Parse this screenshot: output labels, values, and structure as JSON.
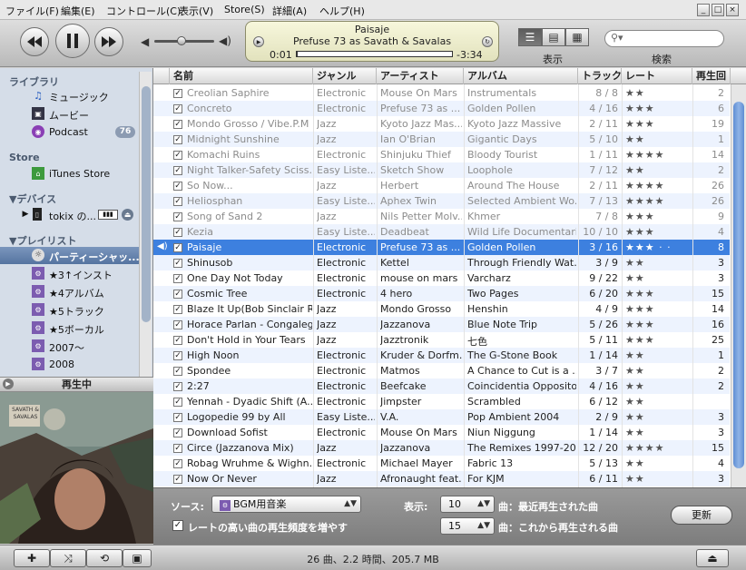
{
  "menu": [
    "ファイル(F)",
    "編集(E)",
    "コントロール(C)",
    "表示(V)",
    "Store(S)",
    "詳細(A)",
    "ヘルプ(H)"
  ],
  "window_buttons": {
    "minimize": "_",
    "maximize": "□",
    "close": "×"
  },
  "lcd": {
    "title": "Paisaje",
    "subtitle": "Prefuse 73 as Savath & Savalas",
    "elapsed": "0:01",
    "remaining": "-3:34",
    "progress": 0.005
  },
  "volume": 0.45,
  "toolbar": {
    "view_label": "表示",
    "search_label": "検索"
  },
  "sidebar": {
    "sections": [
      {
        "header": "ライブラリ",
        "items": [
          {
            "label": "ミュージック"
          },
          {
            "label": "ムービー"
          },
          {
            "label": "Podcast",
            "badge": "76"
          }
        ]
      },
      {
        "header": "Store",
        "items": [
          {
            "label": "iTunes Store"
          }
        ]
      },
      {
        "header": "▼デバイス",
        "items": [
          {
            "label": "tokix の..."
          }
        ]
      },
      {
        "header": "▼プレイリスト",
        "items": [
          {
            "label": "パーティーシャッ...",
            "selected": true
          },
          {
            "label": "★3↑インスト"
          },
          {
            "label": "★4アルバム"
          },
          {
            "label": "★5トラック"
          },
          {
            "label": "★5ボーカル"
          },
          {
            "label": "2007〜"
          },
          {
            "label": "2008"
          }
        ]
      }
    ]
  },
  "now_playing_label": "再生中",
  "album_art_text": "SAVATH & SAVALAS",
  "table": {
    "columns": [
      "名前",
      "ジャンル",
      "アーティスト",
      "アルバム",
      "トラック",
      "レート",
      "再生回"
    ],
    "rows": [
      {
        "name": "Creolian Saphire",
        "genre": "Electronic",
        "artist": "Mouse On Mars",
        "album": "Instrumentals",
        "track": "8 / 8",
        "rating": 2,
        "plays": "2",
        "dim": true
      },
      {
        "name": "Concreto",
        "genre": "Electronic",
        "artist": "Prefuse 73 as ...",
        "album": "Golden Pollen",
        "track": "4 / 16",
        "rating": 3,
        "plays": "6",
        "dim": true
      },
      {
        "name": "Mondo Grosso / Vibe.P.M",
        "genre": "Jazz",
        "artist": "Kyoto Jazz Mas...",
        "album": "Kyoto Jazz Massive",
        "track": "2 / 11",
        "rating": 3,
        "plays": "19",
        "dim": true
      },
      {
        "name": "Midnight Sunshine",
        "genre": "Jazz",
        "artist": "Ian O'Brian",
        "album": "Gigantic Days",
        "track": "5 / 10",
        "rating": 2,
        "plays": "1",
        "dim": true
      },
      {
        "name": "Komachi Ruins",
        "genre": "Electronic",
        "artist": "Shinjuku Thief",
        "album": "Bloody Tourist",
        "track": "1 / 11",
        "rating": 4,
        "plays": "14",
        "dim": true
      },
      {
        "name": "Night Talker-Safety Sciss...",
        "genre": "Easy Liste...",
        "artist": "Sketch Show",
        "album": "Loophole",
        "track": "7 / 12",
        "rating": 2,
        "plays": "2",
        "dim": true
      },
      {
        "name": "So Now...",
        "genre": "Jazz",
        "artist": "Herbert",
        "album": "Around The House",
        "track": "2 / 11",
        "rating": 4,
        "plays": "26",
        "dim": true
      },
      {
        "name": "Heliosphan",
        "genre": "Easy Liste...",
        "artist": "Aphex Twin",
        "album": "Selected Ambient Wo...",
        "track": "7 / 13",
        "rating": 4,
        "plays": "26",
        "dim": true
      },
      {
        "name": "Song of Sand 2",
        "genre": "Jazz",
        "artist": "Nils Petter Molv...",
        "album": "Khmer",
        "track": "7 / 8",
        "rating": 3,
        "plays": "9",
        "dim": true
      },
      {
        "name": "Kezia",
        "genre": "Easy Liste...",
        "artist": "Deadbeat",
        "album": "Wild Life Documentaries",
        "track": "10 / 10",
        "rating": 3,
        "plays": "4",
        "dim": true
      },
      {
        "name": "Paisaje",
        "genre": "Electronic",
        "artist": "Prefuse 73 as ...",
        "album": "Golden Pollen",
        "track": "3 / 16",
        "rating": 3,
        "plays": "8",
        "playing": true
      },
      {
        "name": "Shinusob",
        "genre": "Electronic",
        "artist": "Kettel",
        "album": "Through Friendly Wat...",
        "track": "3 / 9",
        "rating": 2,
        "plays": "3"
      },
      {
        "name": "One Day Not Today",
        "genre": "Electronic",
        "artist": "mouse on mars",
        "album": "Varcharz",
        "track": "9 / 22",
        "rating": 2,
        "plays": "3"
      },
      {
        "name": "Cosmic Tree",
        "genre": "Electronic",
        "artist": "4 hero",
        "album": "Two Pages",
        "track": "6 / 20",
        "rating": 3,
        "plays": "15"
      },
      {
        "name": "Blaze It Up(Bob Sinclair R...",
        "genre": "Jazz",
        "artist": "Mondo Grosso",
        "album": "Henshin",
        "track": "4 / 9",
        "rating": 3,
        "plays": "14"
      },
      {
        "name": "Horace Parlan - Congalegra",
        "genre": "Jazz",
        "artist": "Jazzanova",
        "album": "Blue Note Trip",
        "track": "5 / 26",
        "rating": 3,
        "plays": "16"
      },
      {
        "name": "Don't Hold in Your Tears",
        "genre": "Jazz",
        "artist": "Jazztronik",
        "album": "七色",
        "track": "5 / 11",
        "rating": 3,
        "plays": "25"
      },
      {
        "name": "High Noon",
        "genre": "Electronic",
        "artist": "Kruder & Dorfm...",
        "album": "The G-Stone Book",
        "track": "1 / 14",
        "rating": 2,
        "plays": "1"
      },
      {
        "name": "Spondee",
        "genre": "Electronic",
        "artist": "Matmos",
        "album": "A Chance to Cut is a ...",
        "track": "3 / 7",
        "rating": 2,
        "plays": "2"
      },
      {
        "name": "2:27",
        "genre": "Electronic",
        "artist": "Beefcake",
        "album": "Coincidentia Opposito...",
        "track": "4 / 16",
        "rating": 2,
        "plays": "2"
      },
      {
        "name": "Yennah - Dyadic Shift (A...",
        "genre": "Electronic",
        "artist": "Jimpster",
        "album": "Scrambled",
        "track": "6 / 12",
        "rating": 2,
        "plays": ""
      },
      {
        "name": "Logopedie 99 by All",
        "genre": "Easy Liste...",
        "artist": "V.A.",
        "album": "Pop Ambient 2004",
        "track": "2 / 9",
        "rating": 2,
        "plays": "3"
      },
      {
        "name": "Download Sofist",
        "genre": "Electronic",
        "artist": "Mouse On Mars",
        "album": "Niun Niggung",
        "track": "1 / 14",
        "rating": 2,
        "plays": "3"
      },
      {
        "name": "Circe (Jazzanova Mix)",
        "genre": "Jazz",
        "artist": "Jazzanova",
        "album": "The Remixes 1997-2000",
        "track": "12 / 20",
        "rating": 4,
        "plays": "15"
      },
      {
        "name": "Robag Wruhme & Wighn...",
        "genre": "Electronic",
        "artist": "Michael Mayer",
        "album": "Fabric 13",
        "track": "5 / 13",
        "rating": 2,
        "plays": "4"
      },
      {
        "name": "Now Or Never",
        "genre": "Jazz",
        "artist": "Afronaught feat.",
        "album": "For KJM",
        "track": "6 / 11",
        "rating": 2,
        "plays": "3"
      }
    ]
  },
  "party": {
    "source_label": "ソース:",
    "source_value": "BGM用音楽",
    "display_label": "表示:",
    "recent_count": "10",
    "recent_label": "曲：最近再生された曲",
    "upcoming_count": "15",
    "upcoming_label": "曲：これから再生される曲",
    "boost_label": "レートの高い曲の再生頻度を増やす",
    "update_label": "更新"
  },
  "status_text": "26 曲、2.2 時間、205.7 MB",
  "colors": {
    "selection": "#3d80df",
    "sidebar_bg": "#d5dde8",
    "lcd_bg": "#f0f0d0"
  }
}
